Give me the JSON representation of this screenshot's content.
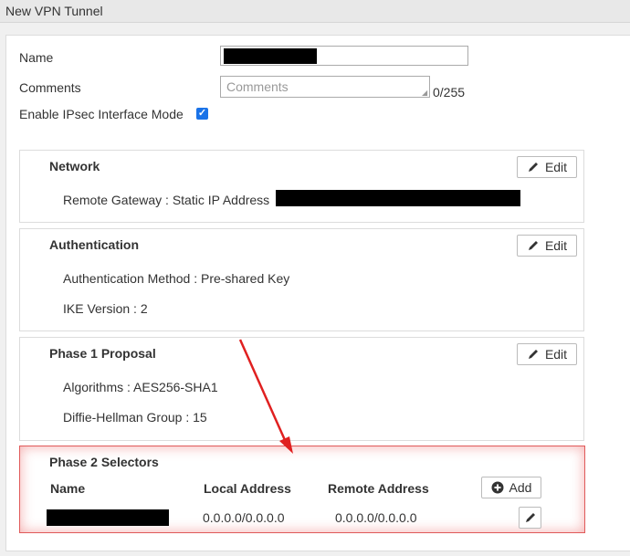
{
  "window": {
    "title": "New VPN Tunnel"
  },
  "form": {
    "name_label": "Name",
    "comments_label": "Comments",
    "comments_placeholder": "Comments",
    "comments_count": "0/255",
    "ipsec_label": "Enable IPsec Interface Mode",
    "ipsec_checked": true
  },
  "sections": {
    "network": {
      "title": "Network",
      "edit_label": "Edit",
      "remote_gateway_label": "Remote Gateway : Static IP Address"
    },
    "authentication": {
      "title": "Authentication",
      "edit_label": "Edit",
      "method_line": "Authentication Method : Pre-shared Key",
      "ike_line": "IKE Version : 2"
    },
    "phase1": {
      "title": "Phase 1 Proposal",
      "edit_label": "Edit",
      "algorithms_line": "Algorithms : AES256-SHA1",
      "dh_line": "Diffie-Hellman Group : 15"
    },
    "phase2": {
      "title": "Phase 2 Selectors",
      "columns": [
        "Name",
        "Local Address",
        "Remote Address"
      ],
      "add_label": "Add",
      "rows": [
        {
          "local": "0.0.0.0/0.0.0.0",
          "remote": "0.0.0.0/0.0.0.0"
        }
      ]
    }
  },
  "icons": {
    "edit": "pencil-icon",
    "add": "plus-circle-icon",
    "check": "checkmark-icon"
  },
  "colors": {
    "highlight_border": "#e05a5a",
    "checkbox": "#1a73e8",
    "annotation_arrow": "#e02020"
  }
}
